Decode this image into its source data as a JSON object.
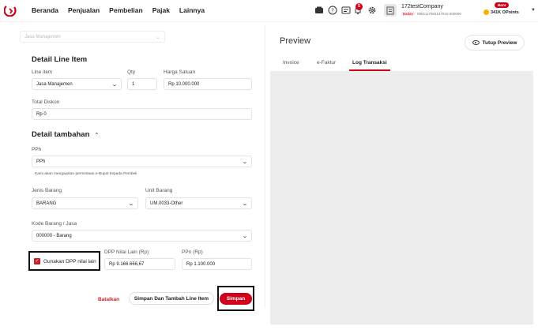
{
  "nav": {
    "items": [
      "Beranda",
      "Penjualan",
      "Pembelian",
      "Pajak",
      "Lainnya"
    ],
    "notif_count": "5"
  },
  "company": {
    "name": "172testCompany",
    "type_tag": "Badan",
    "npwp": "0951117993137010-000000"
  },
  "points": {
    "new_badge": "Baru",
    "label": "341K OPoints"
  },
  "form": {
    "top_field_value": "Jasa Manajemen",
    "detail_heading": "Detail Line Item",
    "line_item_label": "Line item",
    "line_item_value": "Jasa Manajemen",
    "qty_label": "Qty",
    "qty_value": "1",
    "harga_label": "Harga Satuan",
    "harga_value": "Rp 10.000.000",
    "diskon_label": "Total Diskon",
    "diskon_value": "Rp 0",
    "tambahan_heading": "Detail tambahan",
    "pph_label": "PPh",
    "pph_value": "PPh",
    "pph_note": "Kami akan mengajukan permintaan e-Bupot kepada Pembeli",
    "jenis_label": "Jenis Barang",
    "jenis_value": "BARANG",
    "unit_label": "Unit Barang",
    "unit_value": "UM.0033-Other",
    "kode_label": "Kode Barang / Jasa",
    "kode_value": "000000 - Barang",
    "dpp_check_label": "Gunakan DPP nilai lain",
    "dpp_label": "DPP Nilai Lain (Rp)",
    "dpp_value": "Rp 9.166.666,67",
    "ppn_label": "PPn (Rp)",
    "ppn_value": "Rp 1.100.000"
  },
  "actions": {
    "cancel": "Batalkan",
    "save_add": "Simpan Dan Tambah Line Item",
    "save": "Simpan"
  },
  "preview": {
    "title": "Preview",
    "close_label": "Tutup Preview",
    "tabs": [
      "Invoice",
      "e-Faktur",
      "Log Transaksi"
    ],
    "active_tab": "Log Transaksi"
  },
  "colors": {
    "brand": "#d0021b",
    "panel_bg": "#ededed"
  }
}
